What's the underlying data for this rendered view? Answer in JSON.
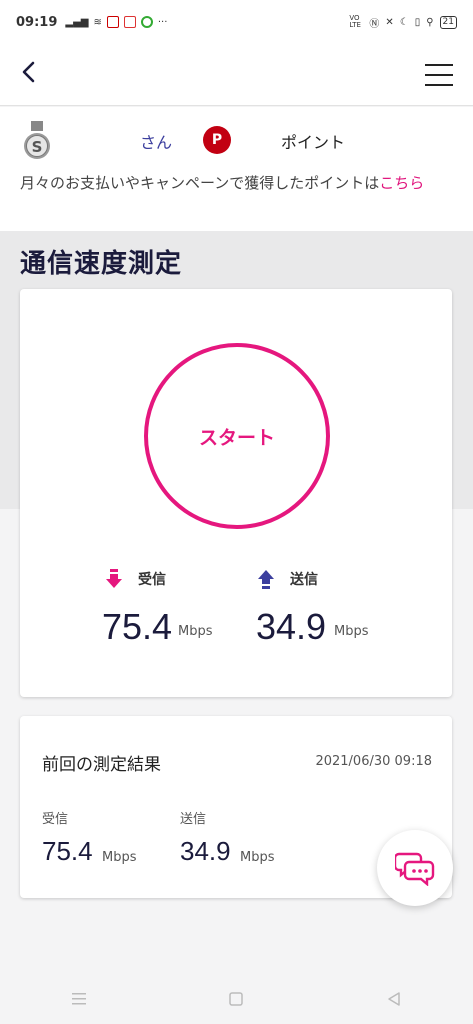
{
  "status_bar": {
    "time": "09:19",
    "battery": "21",
    "volte": "VO LTE"
  },
  "header": {
    "back_icon": "chevron-left-icon",
    "menu_icon": "hamburger-menu-icon"
  },
  "user": {
    "rank_icon": "silver-medal-icon",
    "rank_letter": "S",
    "name_suffix": "さん",
    "points_badge": "P",
    "points_label": "ポイント",
    "description": "月々のお支払いやキャンペーンで獲得したポイントは",
    "link_text": "こちら"
  },
  "speed_test": {
    "title": "通信速度測定",
    "start_label": "スタート",
    "download_label": "受信",
    "download_value": "75.4",
    "download_unit": "Mbps",
    "upload_label": "送信",
    "upload_value": "34.9",
    "upload_unit": "Mbps"
  },
  "last_result": {
    "title": "前回の測定結果",
    "date": "2021/06/30 09:18",
    "download_label": "受信",
    "download_value": "75.4",
    "download_unit": "Mbps",
    "upload_label": "送信",
    "upload_value": "34.9",
    "upload_unit": "Mbps"
  },
  "colors": {
    "accent": "#e5177e",
    "navy": "#1b1b3c",
    "points_red": "#c20012"
  }
}
